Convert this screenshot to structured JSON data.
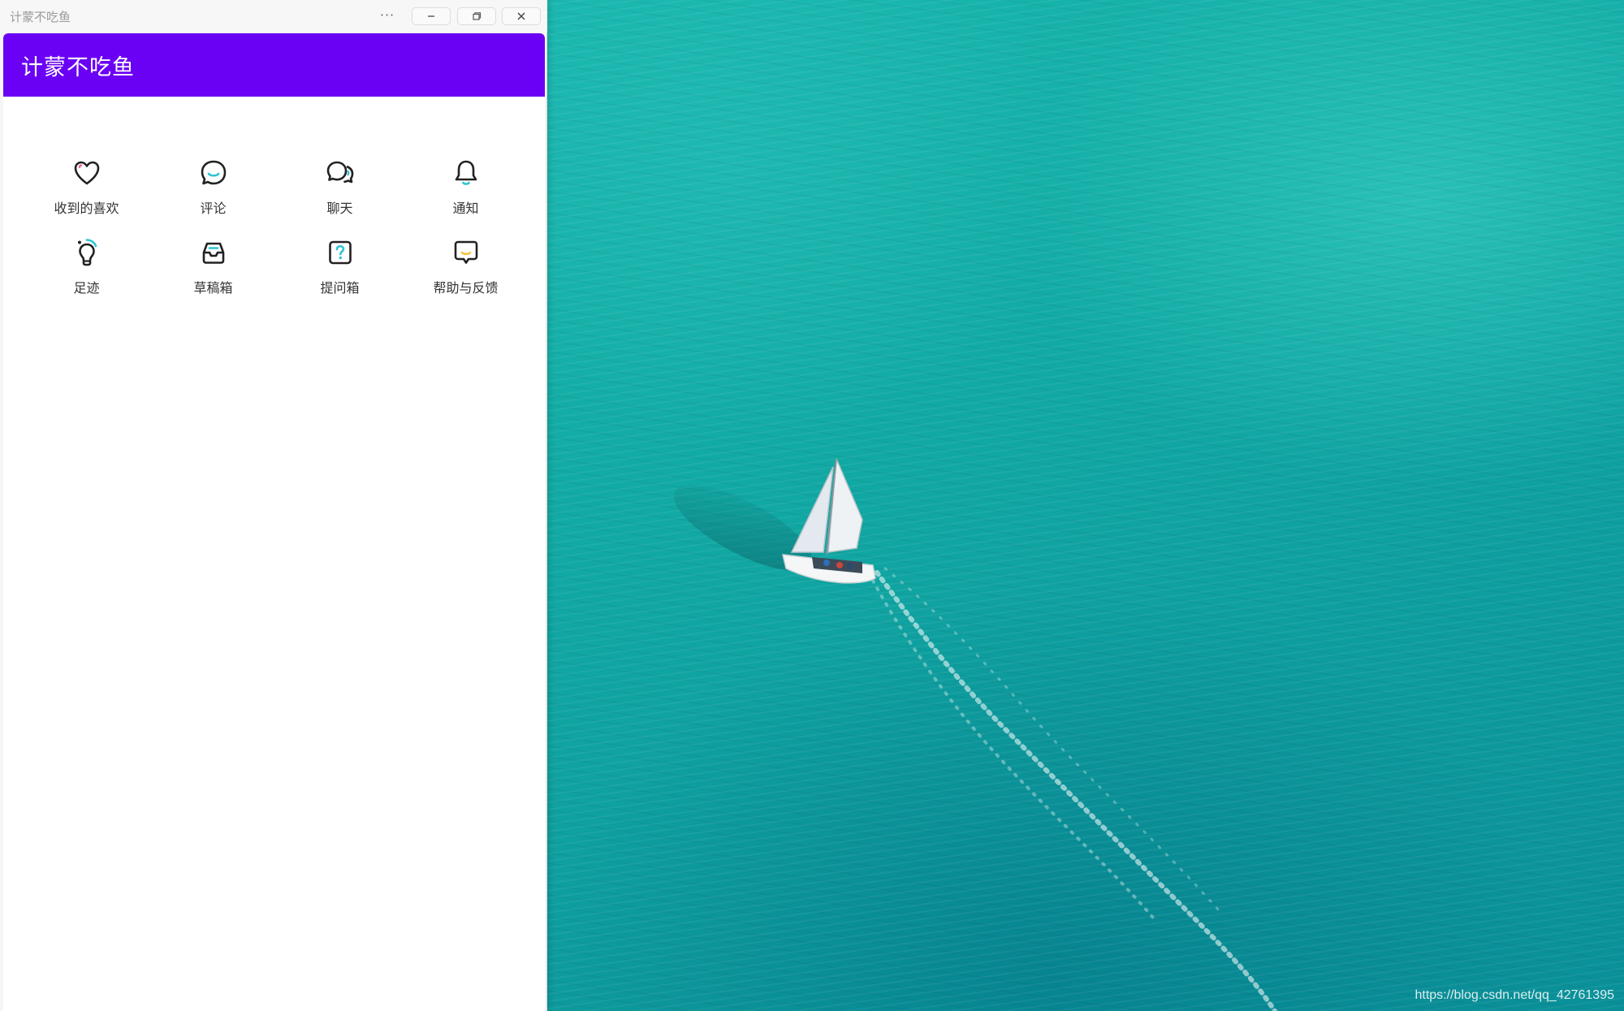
{
  "window": {
    "title": "计蒙不吃鱼",
    "more_label": "···"
  },
  "header": {
    "title": "计蒙不吃鱼"
  },
  "menu": [
    {
      "label": "收到的喜欢",
      "icon": "heart-icon"
    },
    {
      "label": "评论",
      "icon": "comment-icon"
    },
    {
      "label": "聊天",
      "icon": "chat-icon"
    },
    {
      "label": "通知",
      "icon": "bell-icon"
    },
    {
      "label": "足迹",
      "icon": "footprint-bulb-icon"
    },
    {
      "label": "草稿箱",
      "icon": "inbox-tray-icon"
    },
    {
      "label": "提问箱",
      "icon": "question-box-icon"
    },
    {
      "label": "帮助与反馈",
      "icon": "feedback-message-icon"
    }
  ],
  "desktop": {
    "watermark": "https://blog.csdn.net/qq_42761395"
  },
  "colors": {
    "header_bg": "#6a00f4",
    "accent_teal": "#2ec4d4",
    "accent_pink": "#f06292",
    "accent_yellow": "#f7c23a",
    "icon_stroke": "#222222"
  }
}
